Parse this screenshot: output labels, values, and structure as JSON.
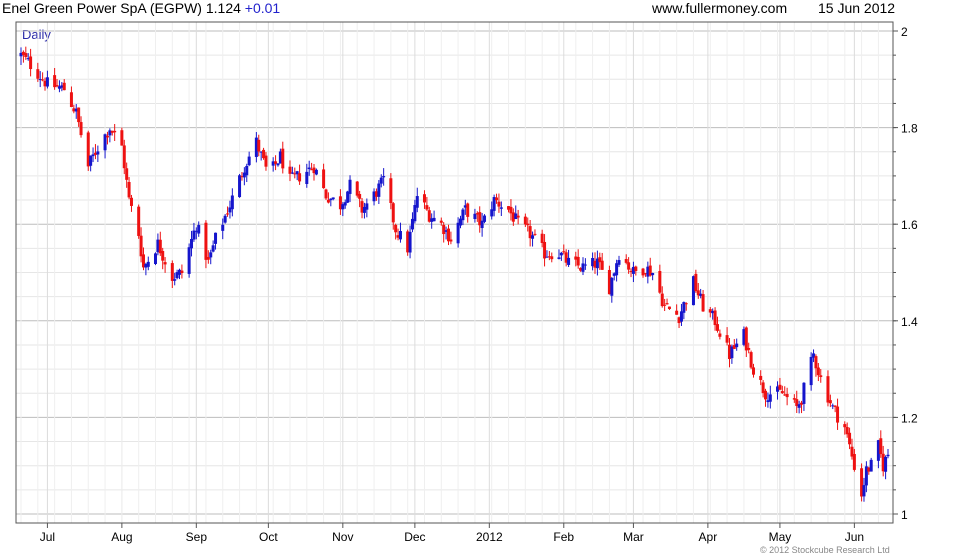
{
  "header": {
    "title": "Enel Green Power SpA (EGPW)",
    "last_price": "1.124",
    "change": "+0.01",
    "source": "www.fullermoney.com",
    "date": "15 Jun 2012"
  },
  "period_label": "Daily",
  "copyright": "© 2012 Stockcube Research Ltd",
  "colors": {
    "up": "#1515cc",
    "down": "#ee1111",
    "grid": "#cfcfcf",
    "frame": "#555555"
  },
  "chart_data": {
    "type": "candlestick",
    "title": "Enel Green Power SpA (EGPW) 1.124 +0.01",
    "xlabel": "",
    "ylabel": "",
    "ylim": [
      1.0,
      2.0
    ],
    "yticks": [
      1,
      1.2,
      1.4,
      1.6,
      1.8,
      2
    ],
    "yticklabels": [
      "1",
      "1.2",
      "1.4",
      "1.6",
      "1.8",
      "2"
    ],
    "x_tick_labels": [
      "Jul",
      "Aug",
      "Sep",
      "Oct",
      "Nov",
      "Dec",
      "2012",
      "Feb",
      "Mar",
      "Apr",
      "May",
      "Jun"
    ],
    "x_tick_dates": [
      "2011-07-01",
      "2011-08-01",
      "2011-09-01",
      "2011-10-01",
      "2011-11-01",
      "2011-12-01",
      "2012-01-01",
      "2012-02-01",
      "2012-03-01",
      "2012-04-01",
      "2012-05-01",
      "2012-06-01"
    ],
    "x_range": [
      "2011-06-20",
      "2012-06-15"
    ],
    "grid": true,
    "close_path": [
      [
        "2011-06-20",
        1.95
      ],
      [
        "2011-06-24",
        1.93
      ],
      [
        "2011-07-01",
        1.89
      ],
      [
        "2011-07-08",
        1.88
      ],
      [
        "2011-07-13",
        1.83
      ],
      [
        "2011-07-18",
        1.72
      ],
      [
        "2011-07-22",
        1.76
      ],
      [
        "2011-07-27",
        1.8
      ],
      [
        "2011-08-01",
        1.76
      ],
      [
        "2011-08-04",
        1.65
      ],
      [
        "2011-08-08",
        1.58
      ],
      [
        "2011-08-10",
        1.51
      ],
      [
        "2011-08-16",
        1.56
      ],
      [
        "2011-08-22",
        1.49
      ],
      [
        "2011-08-26",
        1.5
      ],
      [
        "2011-09-01",
        1.6
      ],
      [
        "2011-09-06",
        1.52
      ],
      [
        "2011-09-09",
        1.57
      ],
      [
        "2011-09-15",
        1.64
      ],
      [
        "2011-09-21",
        1.72
      ],
      [
        "2011-09-26",
        1.77
      ],
      [
        "2011-10-01",
        1.7
      ],
      [
        "2011-10-06",
        1.74
      ],
      [
        "2011-10-10",
        1.69
      ],
      [
        "2011-10-14",
        1.7
      ],
      [
        "2011-10-20",
        1.72
      ],
      [
        "2011-10-25",
        1.66
      ],
      [
        "2011-10-31",
        1.64
      ],
      [
        "2011-11-04",
        1.68
      ],
      [
        "2011-11-09",
        1.63
      ],
      [
        "2011-11-14",
        1.66
      ],
      [
        "2011-11-18",
        1.69
      ],
      [
        "2011-11-23",
        1.59
      ],
      [
        "2011-11-28",
        1.55
      ],
      [
        "2011-12-02",
        1.66
      ],
      [
        "2011-12-07",
        1.62
      ],
      [
        "2011-12-12",
        1.6
      ],
      [
        "2011-12-16",
        1.57
      ],
      [
        "2011-12-22",
        1.63
      ],
      [
        "2011-12-29",
        1.6
      ],
      [
        "2012-01-03",
        1.65
      ],
      [
        "2012-01-09",
        1.63
      ],
      [
        "2012-01-13",
        1.6
      ],
      [
        "2012-01-18",
        1.58
      ],
      [
        "2012-01-24",
        1.54
      ],
      [
        "2012-01-30",
        1.54
      ],
      [
        "2012-02-03",
        1.52
      ],
      [
        "2012-02-09",
        1.51
      ],
      [
        "2012-02-15",
        1.52
      ],
      [
        "2012-02-20",
        1.47
      ],
      [
        "2012-02-24",
        1.54
      ],
      [
        "2012-03-01",
        1.5
      ],
      [
        "2012-03-06",
        1.51
      ],
      [
        "2012-03-09",
        1.5
      ],
      [
        "2012-03-14",
        1.43
      ],
      [
        "2012-03-20",
        1.41
      ],
      [
        "2012-03-26",
        1.48
      ],
      [
        "2012-03-30",
        1.43
      ],
      [
        "2012-04-04",
        1.4
      ],
      [
        "2012-04-10",
        1.33
      ],
      [
        "2012-04-16",
        1.37
      ],
      [
        "2012-04-20",
        1.3
      ],
      [
        "2012-04-25",
        1.25
      ],
      [
        "2012-05-02",
        1.25
      ],
      [
        "2012-05-08",
        1.22
      ],
      [
        "2012-05-10",
        1.24
      ],
      [
        "2012-05-15",
        1.33
      ],
      [
        "2012-05-18",
        1.28
      ],
      [
        "2012-05-23",
        1.22
      ],
      [
        "2012-05-28",
        1.18
      ],
      [
        "2012-06-01",
        1.1
      ],
      [
        "2012-06-04",
        1.04
      ],
      [
        "2012-06-06",
        1.09
      ],
      [
        "2012-06-08",
        1.1
      ],
      [
        "2012-06-11",
        1.14
      ],
      [
        "2012-06-13",
        1.1
      ],
      [
        "2012-06-15",
        1.124
      ]
    ]
  }
}
